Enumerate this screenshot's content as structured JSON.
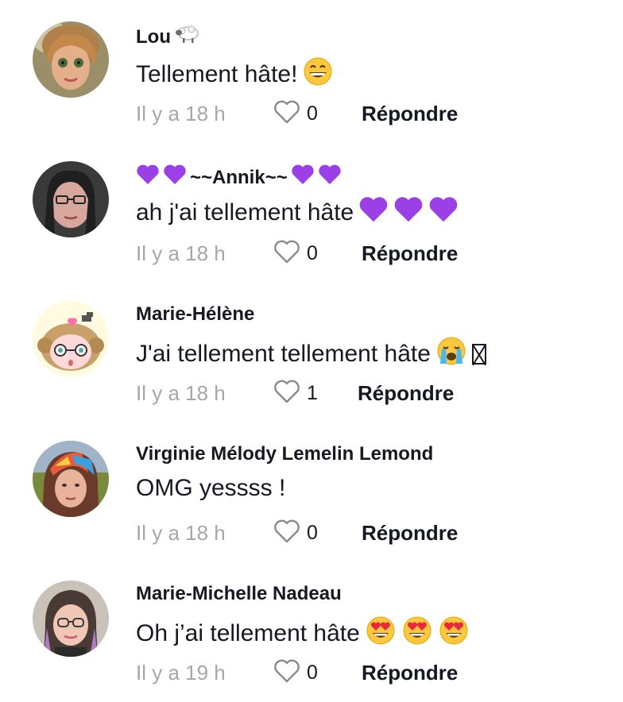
{
  "comments": [
    {
      "username": "Lou",
      "username_suffix_icon": "sheep-icon",
      "text": "Tellement hâte!",
      "text_emojis": [
        "grinning-face-icon"
      ],
      "time": "Il y a 18 h",
      "likes": "0",
      "reply_label": "Répondre"
    },
    {
      "username": "~~Annik~~",
      "username_prefix_icons": [
        "purple-heart-icon",
        "purple-heart-icon"
      ],
      "username_suffix_icons": [
        "purple-heart-icon",
        "purple-heart-icon"
      ],
      "text": "ah j'ai tellement hâte",
      "text_emojis": [
        "purple-heart-icon",
        "purple-heart-icon",
        "purple-heart-icon"
      ],
      "time": "Il y a 18 h",
      "likes": "0",
      "reply_label": "Répondre"
    },
    {
      "username": "Marie-Hélène",
      "text": "J'ai tellement tellement hâte",
      "text_emojis": [
        "loudly-crying-face-icon",
        "missing-glyph-icon"
      ],
      "time": "Il y a 18 h",
      "likes": "1",
      "reply_label": "Répondre"
    },
    {
      "username": "Virginie Mélody Lemelin Lemond",
      "text": "OMG yessss !",
      "time": "Il y a 18 h",
      "likes": "0",
      "reply_label": "Répondre"
    },
    {
      "username": "Marie-Michelle Nadeau",
      "text": "Oh j’ai tellement hâte",
      "text_emojis": [
        "heart-eyes-face-icon",
        "heart-eyes-face-icon",
        "heart-eyes-face-icon"
      ],
      "time": "Il y a 19 h",
      "likes": "0",
      "reply_label": "Répondre"
    }
  ],
  "colors": {
    "text": "#161823",
    "muted": "#a6a7ab",
    "purple_heart": "#9b3fe6",
    "emoji_yellow": "#ffc83d",
    "heart_red": "#e8283c"
  }
}
